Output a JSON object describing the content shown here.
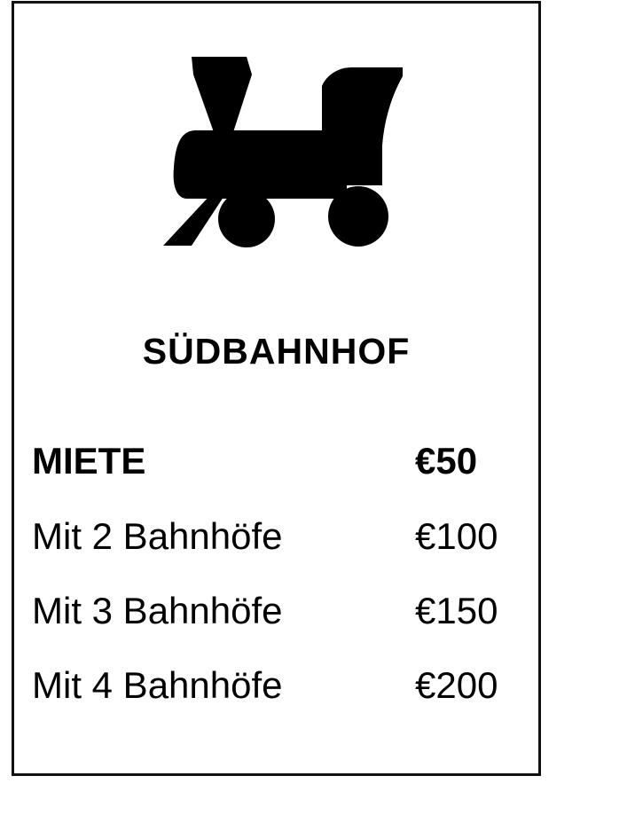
{
  "card": {
    "icon": "locomotive-icon",
    "title": "SÜDBAHNHOF",
    "base_rent": {
      "label": "MIETE",
      "value": "€50"
    },
    "rents": [
      {
        "label": "Mit 2 Bahnhöfe",
        "value": "€100"
      },
      {
        "label": "Mit 3 Bahnhöfe",
        "value": "€150"
      },
      {
        "label": "Mit 4 Bahnhöfe",
        "value": "€200"
      }
    ]
  },
  "colors": {
    "border": "#111111",
    "ink": "#000000",
    "background": "#ffffff"
  }
}
